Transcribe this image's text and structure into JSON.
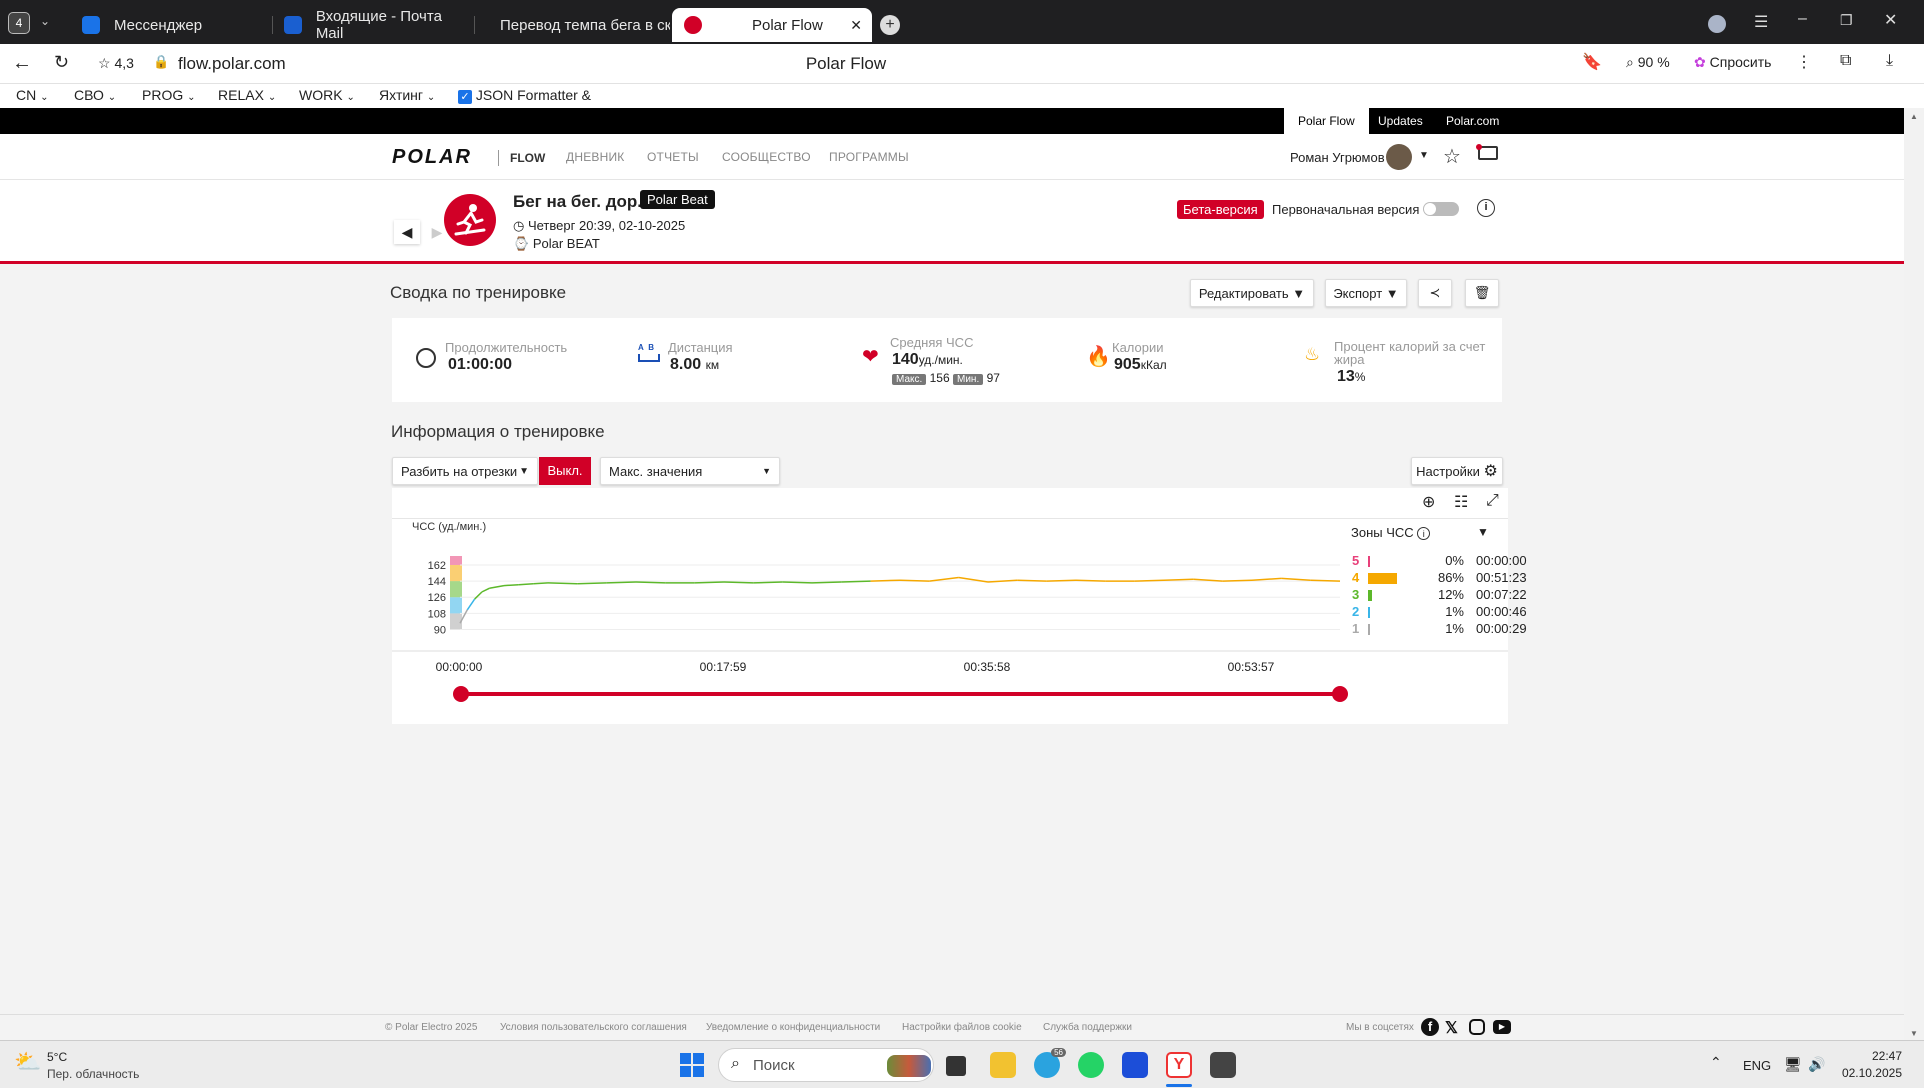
{
  "browser": {
    "tab_count": "4",
    "tabs": [
      {
        "label": "Мессенджер"
      },
      {
        "label": "Входящие - Почта Mail"
      },
      {
        "label": "Перевод темпа бега в ско"
      },
      {
        "label": "Polar Flow"
      }
    ],
    "rating": "4,3",
    "url": "flow.polar.com",
    "page_title": "Polar Flow",
    "zoom": "90 %",
    "ask_label": "Спросить",
    "bookmarks": [
      "CN",
      "СВО",
      "PROG",
      "RELAX",
      "WORK",
      "Яхтинг",
      "JSON Formatter &"
    ]
  },
  "topbar": {
    "tabs": [
      "Polar Flow",
      "Updates",
      "Polar.com"
    ]
  },
  "nav": {
    "brand": "POLAR",
    "product": "FLOW",
    "links": [
      "ДНЕВНИК",
      "ОТЧЕТЫ",
      "СООБЩЕСТВО",
      "ПРОГРАММЫ"
    ],
    "user_name": "Роман Угрюмов"
  },
  "session": {
    "title": "Бег на бег. дор.",
    "device_badge": "Polar Beat",
    "datetime": "Четверг 20:39, 02-10-2025",
    "device": "Polar BEAT",
    "beta_label": "Бета-версия",
    "original_version_label": "Первоначальная версия"
  },
  "summary": {
    "heading": "Сводка по тренировке",
    "edit_label": "Редактировать",
    "export_label": "Экспорт",
    "duration": {
      "label": "Продолжительность",
      "value": "01:00:00"
    },
    "distance": {
      "label": "Дистанция",
      "value": "8.00",
      "unit": "км"
    },
    "hr": {
      "label": "Средняя ЧСС",
      "value": "140",
      "unit": "уд./мин.",
      "max_label": "Макс.",
      "max": "156",
      "min_label": "Мин.",
      "min": "97"
    },
    "calories": {
      "label": "Калории",
      "value": "905",
      "unit": "кКал"
    },
    "fat": {
      "label": "Процент калорий за счет жира",
      "value": "13",
      "unit": "%"
    }
  },
  "info": {
    "heading": "Информация о тренировке",
    "split_label": "Разбить на отрезки",
    "off_label": "Выкл.",
    "max_values_label": "Макс. значения",
    "settings_label": "Настройки"
  },
  "chart_data": {
    "type": "line",
    "ylabel": "ЧСС (уд./мин.)",
    "yticks": [
      90,
      108,
      126,
      144,
      162
    ],
    "ylim": [
      85,
      172
    ],
    "x_tick_labels": [
      "00:00:00",
      "00:17:59",
      "00:35:58",
      "00:53:57"
    ],
    "xlim": [
      0,
      60
    ],
    "x_unit": "minutes",
    "series": [
      {
        "x": [
          0,
          0.5,
          1,
          1.5,
          2,
          3,
          4,
          5,
          6,
          8,
          10,
          12,
          14,
          16,
          18,
          20,
          22,
          24,
          26,
          28,
          30,
          32,
          34,
          36,
          38,
          40,
          42,
          44,
          46,
          48,
          50,
          52,
          54,
          56,
          58,
          60
        ],
        "values": [
          97,
          112,
          124,
          132,
          136,
          139,
          140,
          141,
          142,
          141,
          142,
          143,
          142,
          142,
          143,
          142,
          143,
          142,
          143,
          144,
          145,
          144,
          148,
          143,
          145,
          144,
          145,
          144,
          144,
          145,
          146,
          144,
          145,
          147,
          145,
          144
        ]
      }
    ],
    "hr_zones": {
      "label": "Зоны ЧСС",
      "zones": [
        {
          "zone": "5",
          "percent": "0%",
          "time": "00:00:00",
          "color": "#e8407a",
          "share": 0.0
        },
        {
          "zone": "4",
          "percent": "86%",
          "time": "00:51:23",
          "color": "#f5a800",
          "share": 0.86
        },
        {
          "zone": "3",
          "percent": "12%",
          "time": "00:07:22",
          "color": "#5cb82a",
          "share": 0.12
        },
        {
          "zone": "2",
          "percent": "1%",
          "time": "00:00:46",
          "color": "#39b5e8",
          "share": 0.01
        },
        {
          "zone": "1",
          "percent": "1%",
          "time": "00:00:29",
          "color": "#aaaaaa",
          "share": 0.01
        }
      ]
    }
  },
  "footer": {
    "links": [
      "© Polar Electro 2025",
      "Условия пользовательского соглашения",
      "Уведомление о конфиденциальности",
      "Настройки файлов cookie",
      "Служба поддержки"
    ],
    "social_label": "Мы в соцсетях"
  },
  "taskbar": {
    "weather_temp": "5°C",
    "weather_desc": "Пер. облачность",
    "search_placeholder": "Поиск",
    "lang": "ENG",
    "time": "22:47",
    "date": "02.10.2025",
    "telegram_badge": "56"
  },
  "colors": {
    "brand_red": "#d10027",
    "zone4": "#f5a800",
    "zone3": "#5cb82a"
  }
}
